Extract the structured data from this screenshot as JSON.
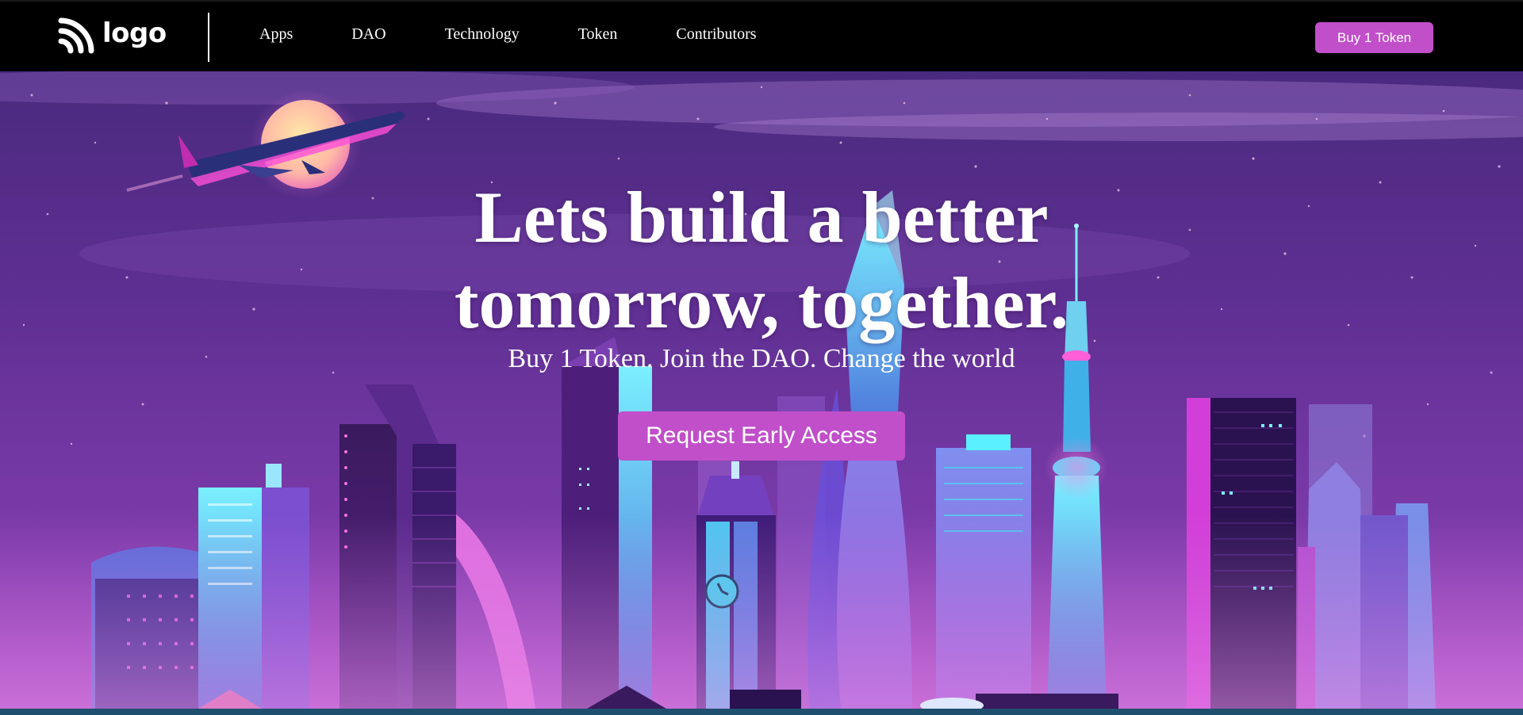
{
  "header": {
    "logo_text": "logo",
    "nav": [
      "Apps",
      "DAO",
      "Technology",
      "Token",
      "Contributors"
    ],
    "buy_button": "Buy 1 Token"
  },
  "hero": {
    "title_line1": "Lets build a better",
    "title_line2": "tomorrow, together.",
    "subtitle": "Buy 1 Token. Join the DAO. Change the world",
    "cta": "Request Early Access",
    "background_icon": "neon-city-skyline-illustration",
    "plane_icon": "airplane-icon",
    "moon_icon": "moon-icon"
  },
  "colors": {
    "nav_bg": "#000000",
    "accent": "#c04fc9",
    "sky_top": "#5a2d8c",
    "sky_mid": "#7b3fb0",
    "sky_bottom": "#b34fd0",
    "neon_cyan": "#36d9f2",
    "neon_pink": "#ff4fd8"
  }
}
